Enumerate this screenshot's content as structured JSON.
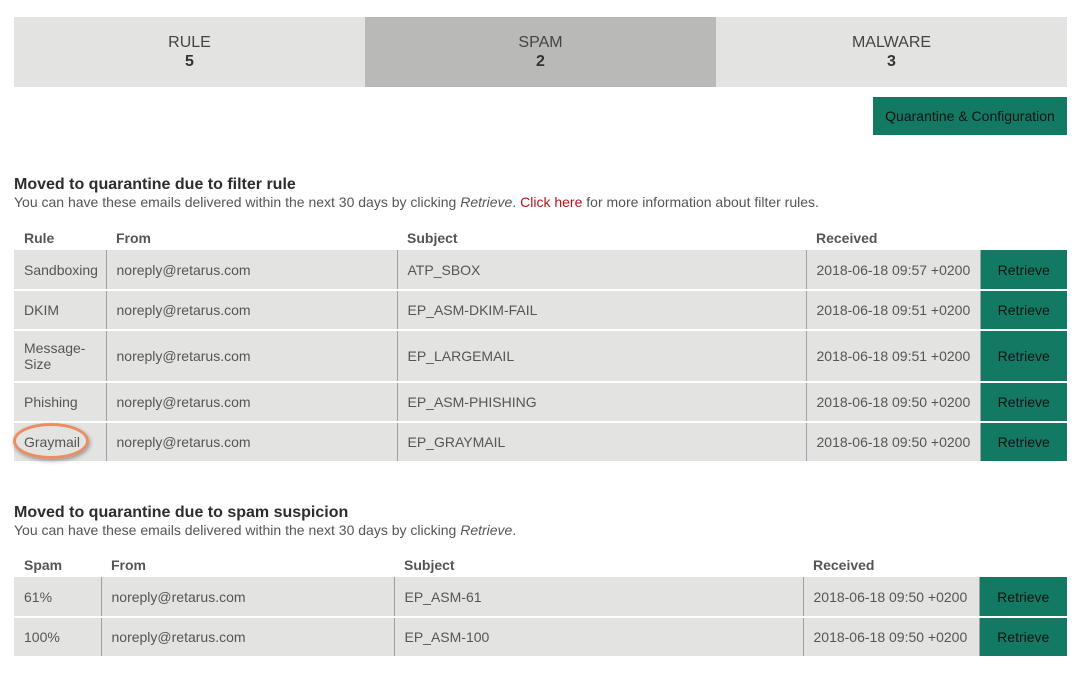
{
  "tabs": [
    {
      "label": "RULE",
      "count": "5"
    },
    {
      "label": "SPAM",
      "count": "2"
    },
    {
      "label": "MALWARE",
      "count": "3"
    }
  ],
  "quarantine_button": "Quarantine & Configuration",
  "filter_section": {
    "title": "Moved to quarantine due to filter rule",
    "desc_before": "You can have these emails delivered within the next 30 days by clicking ",
    "desc_italic": "Retrieve",
    "desc_middle": ". ",
    "link_text": "Click here",
    "desc_after": " for more information about filter rules.",
    "headers": {
      "c1": "Rule",
      "c2": "From",
      "c3": "Subject",
      "c4": "Received"
    },
    "rows": [
      {
        "c1": "Sandboxing",
        "c2": "noreply@retarus.com",
        "c3": "ATP_SBOX",
        "c4": "2018-06-18 09:57 +0200",
        "action": "Retrieve"
      },
      {
        "c1": "DKIM",
        "c2": "noreply@retarus.com",
        "c3": "EP_ASM-DKIM-FAIL",
        "c4": "2018-06-18 09:51 +0200",
        "action": "Retrieve"
      },
      {
        "c1": "Message-Size",
        "c2": "noreply@retarus.com",
        "c3": "EP_LARGEMAIL",
        "c4": "2018-06-18 09:51 +0200",
        "action": "Retrieve"
      },
      {
        "c1": "Phishing",
        "c2": "noreply@retarus.com",
        "c3": "EP_ASM-PHISHING",
        "c4": "2018-06-18 09:50 +0200",
        "action": "Retrieve"
      },
      {
        "c1": "Graymail",
        "c2": "noreply@retarus.com",
        "c3": "EP_GRAYMAIL",
        "c4": "2018-06-18 09:50 +0200",
        "action": "Retrieve"
      }
    ]
  },
  "spam_section": {
    "title": "Moved to quarantine due to spam suspicion",
    "desc_before": "You can have these emails delivered within the next 30 days by clicking ",
    "desc_italic": "Retrieve",
    "desc_after": ".",
    "headers": {
      "c1": "Spam",
      "c2": "From",
      "c3": "Subject",
      "c4": "Received"
    },
    "rows": [
      {
        "c1": "61%",
        "c2": "noreply@retarus.com",
        "c3": "EP_ASM-61",
        "c4": "2018-06-18 09:50 +0200",
        "action": "Retrieve"
      },
      {
        "c1": "100%",
        "c2": "noreply@retarus.com",
        "c3": "EP_ASM-100",
        "c4": "2018-06-18 09:50 +0200",
        "action": "Retrieve"
      }
    ]
  },
  "colors": {
    "accent_green": "#127a63",
    "tab_active": "#b9b9b7",
    "row_bg": "#e3e3e1",
    "link_red": "#b4141e",
    "highlight_orange": "#ec8c63"
  }
}
